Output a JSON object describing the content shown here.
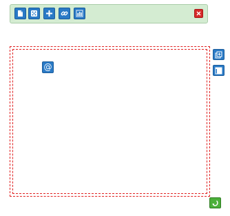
{
  "toolbar": {
    "background": "#d4ecd2",
    "buttons": [
      {
        "icon": "document-icon"
      },
      {
        "icon": "dice-icon"
      },
      {
        "icon": "plus-icon"
      },
      {
        "icon": "link-icon"
      },
      {
        "icon": "chart-icon"
      }
    ],
    "close_icon": "close-icon"
  },
  "canvas": {
    "border_color": "#e02020",
    "at_button_glyph": "@"
  },
  "side_buttons": [
    {
      "icon": "expand-icon"
    },
    {
      "icon": "collapse-icon"
    }
  ],
  "bottom_button": {
    "icon": "refresh-icon",
    "color": "#4caf3a"
  }
}
